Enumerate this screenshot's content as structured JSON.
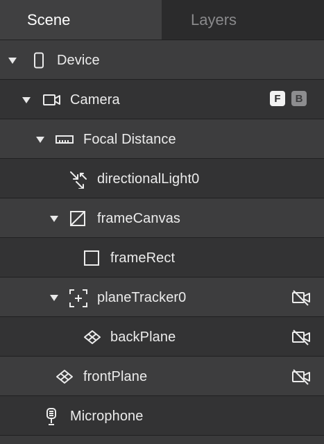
{
  "tabs": {
    "scene": "Scene",
    "layers": "Layers"
  },
  "tree": [
    {
      "label": "Device",
      "icon": "phone-icon",
      "expanded": true
    },
    {
      "label": "Camera",
      "icon": "camera-icon",
      "expanded": true,
      "badges": [
        "F",
        "B"
      ]
    },
    {
      "label": "Focal Distance",
      "icon": "ruler-icon",
      "expanded": true
    },
    {
      "label": "directionalLight0",
      "icon": "directional-light-icon"
    },
    {
      "label": "frameCanvas",
      "icon": "canvas-icon",
      "expanded": true
    },
    {
      "label": "frameRect",
      "icon": "rectangle-icon"
    },
    {
      "label": "planeTracker0",
      "icon": "plane-tracker-icon",
      "expanded": true,
      "status_icon": "camera-off-icon"
    },
    {
      "label": "backPlane",
      "icon": "plane-icon",
      "status_icon": "camera-off-icon"
    },
    {
      "label": "frontPlane",
      "icon": "plane-icon",
      "status_icon": "camera-off-icon"
    },
    {
      "label": "Microphone",
      "icon": "microphone-icon"
    }
  ]
}
